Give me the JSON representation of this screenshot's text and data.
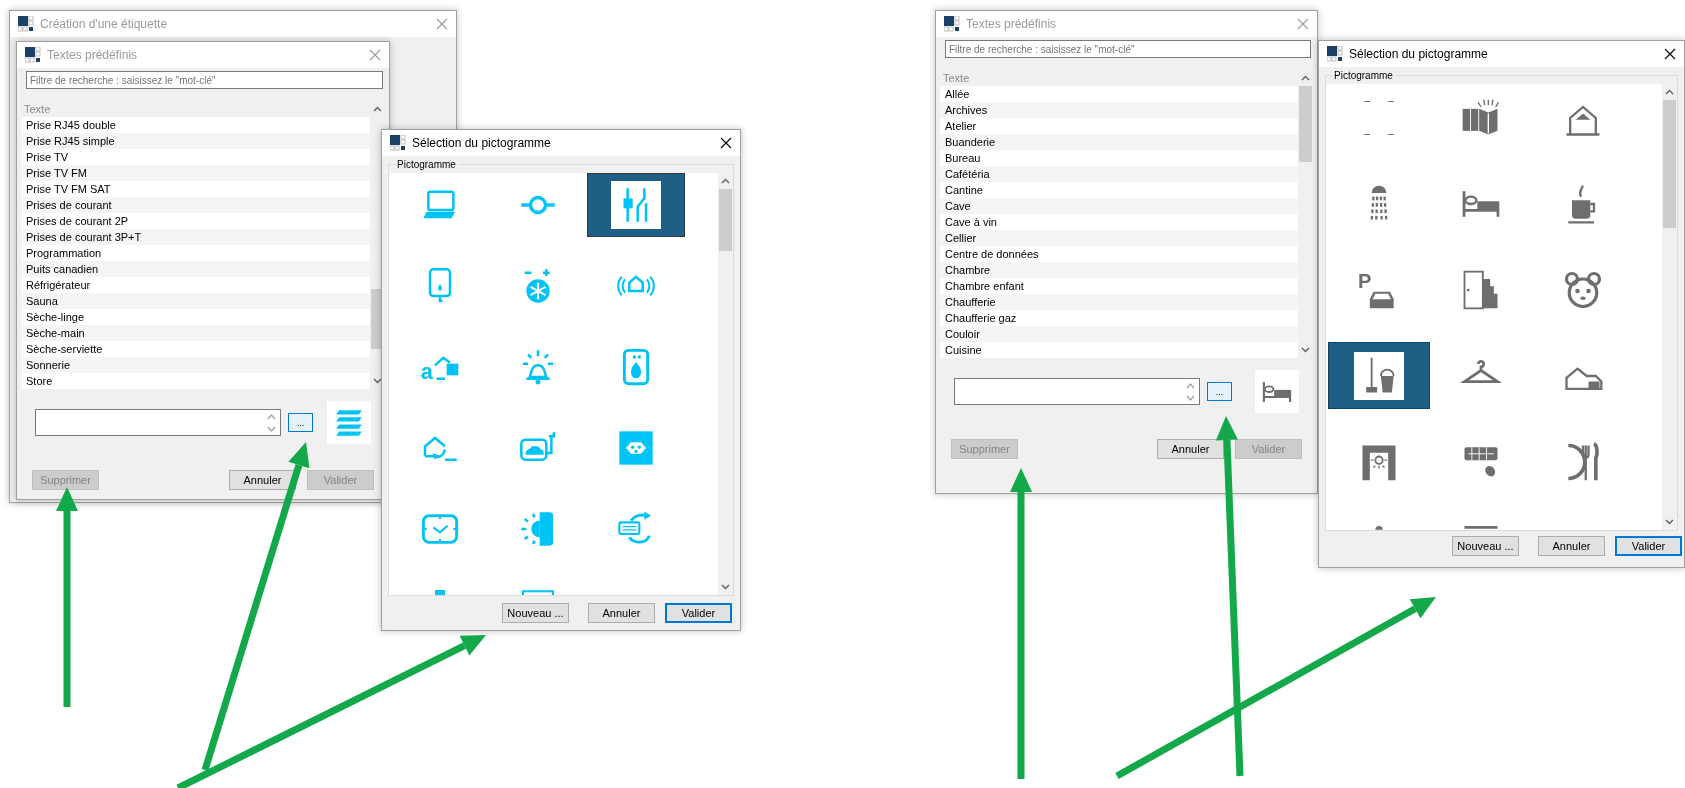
{
  "screens": [
    {
      "label_window": {
        "title": "Création d'une étiquette",
        "active": false
      },
      "texts_dialog": {
        "title": "Textes prédéfinis",
        "active": false,
        "search": {
          "placeholder": "Filtre de recherche : saisissez le \"mot-clé\""
        },
        "list_header": "Texte",
        "items": [
          {
            "label": "Prise RJ45 double",
            "selected": false
          },
          {
            "label": "Prise RJ45 simple",
            "selected": false
          },
          {
            "label": "Prise TV",
            "selected": false
          },
          {
            "label": "Prise TV FM",
            "selected": false
          },
          {
            "label": "Prise TV FM SAT",
            "selected": false
          },
          {
            "label": "Prises de courant",
            "selected": false
          },
          {
            "label": "Prises de courant 2P",
            "selected": false
          },
          {
            "label": "Prises de courant 3P+T",
            "selected": false
          },
          {
            "label": "Programmation",
            "selected": false
          },
          {
            "label": "Puits canadien",
            "selected": false
          },
          {
            "label": "Réfrigérateur",
            "selected": false
          },
          {
            "label": "Sauna",
            "selected": false
          },
          {
            "label": "Sèche-linge",
            "selected": false
          },
          {
            "label": "Sèche-main",
            "selected": false
          },
          {
            "label": "Sèche-serviette",
            "selected": false
          },
          {
            "label": "Sonnerie",
            "selected": false
          },
          {
            "label": "Store",
            "selected": false
          }
        ],
        "browse_button": "...",
        "preview": {
          "kind": "blinds"
        },
        "buttons": [
          {
            "label": "Supprimer",
            "disabled": true
          },
          {
            "label": "Annuler",
            "disabled": false
          },
          {
            "label": "Valider",
            "disabled": true
          }
        ]
      },
      "pictogram_dialog": {
        "title": "Sélection du pictogramme",
        "active": true,
        "group_label": "Pictogramme",
        "pictograms": [
          {
            "kind": "laptop",
            "selected": false
          },
          {
            "kind": "valve",
            "selected": false
          },
          {
            "kind": "meter",
            "selected": true
          },
          {
            "kind": "boiler",
            "selected": false
          },
          {
            "kind": "thermostat-snow",
            "selected": false
          },
          {
            "kind": "house-signal",
            "selected": false
          },
          {
            "kind": "house-letter",
            "glyph": "a",
            "selected": false
          },
          {
            "kind": "alarm-bell",
            "selected": false
          },
          {
            "kind": "gas-boiler",
            "selected": false
          },
          {
            "kind": "house-arrow",
            "selected": false
          },
          {
            "kind": "car-charger",
            "selected": false
          },
          {
            "kind": "socket",
            "selected": false
          },
          {
            "kind": "clock",
            "selected": false
          },
          {
            "kind": "sun-contrast",
            "selected": false
          },
          {
            "kind": "card-refresh",
            "selected": false
          },
          {
            "kind": "stand",
            "selected": false
          },
          {
            "kind": "screen",
            "selected": false
          }
        ],
        "buttons": [
          {
            "label": "Nouveau ...",
            "default": false
          },
          {
            "label": "Annuler",
            "default": false
          },
          {
            "label": "Valider",
            "default": true
          }
        ]
      }
    },
    {
      "texts_dialog": {
        "title": "Textes prédéfinis",
        "active": false,
        "search": {
          "placeholder": "Filtre de recherche : saisissez le \"mot-clé\""
        },
        "list_header": "Texte",
        "items": [
          {
            "label": "Allée",
            "selected": false
          },
          {
            "label": "Archives",
            "selected": false
          },
          {
            "label": "Atelier",
            "selected": false
          },
          {
            "label": "Buanderie",
            "selected": false
          },
          {
            "label": "Bureau",
            "selected": false
          },
          {
            "label": "Cafétéria",
            "selected": false
          },
          {
            "label": "Cantine",
            "selected": false
          },
          {
            "label": "Cave",
            "selected": false
          },
          {
            "label": "Cave à vin",
            "selected": false
          },
          {
            "label": "Cellier",
            "selected": false
          },
          {
            "label": "Centre de données",
            "selected": false
          },
          {
            "label": "Chambre",
            "selected": false
          },
          {
            "label": "Chambre enfant",
            "selected": false
          },
          {
            "label": "Chaufferie",
            "selected": false
          },
          {
            "label": "Chaufferie gaz",
            "selected": false
          },
          {
            "label": "Couloir",
            "selected": false
          },
          {
            "label": "Cuisine",
            "selected": false
          }
        ],
        "browse_button": "...",
        "preview": {
          "kind": "bed"
        },
        "buttons": [
          {
            "label": "Supprimer",
            "disabled": true
          },
          {
            "label": "Annuler",
            "disabled": false
          },
          {
            "label": "Valider",
            "disabled": true
          }
        ]
      },
      "pictogram_dialog": {
        "title": "Sélection du pictogramme",
        "active": true,
        "group_label": "Pictogramme",
        "pictograms": [
          {
            "kind": "corner-marks",
            "selected": false
          },
          {
            "kind": "books",
            "selected": false
          },
          {
            "kind": "house-roof",
            "selected": false
          },
          {
            "kind": "shower",
            "selected": false
          },
          {
            "kind": "bed",
            "selected": false
          },
          {
            "kind": "coffee",
            "selected": false
          },
          {
            "kind": "parking",
            "glyph": "P",
            "selected": false
          },
          {
            "kind": "door-stairs",
            "selected": false
          },
          {
            "kind": "bear",
            "selected": false
          },
          {
            "kind": "cleaning",
            "selected": true
          },
          {
            "kind": "hanger",
            "selected": false
          },
          {
            "kind": "house-garage",
            "selected": false
          },
          {
            "kind": "gate-light",
            "selected": false
          },
          {
            "kind": "keyboard-mouse",
            "selected": false
          },
          {
            "kind": "restaurant",
            "selected": false
          },
          {
            "kind": "lamp",
            "selected": false
          },
          {
            "kind": "shelf",
            "selected": false
          }
        ],
        "buttons": [
          {
            "label": "Nouveau ...",
            "default": false
          },
          {
            "label": "Annuler",
            "default": false
          },
          {
            "label": "Valider",
            "default": true
          }
        ]
      }
    }
  ]
}
